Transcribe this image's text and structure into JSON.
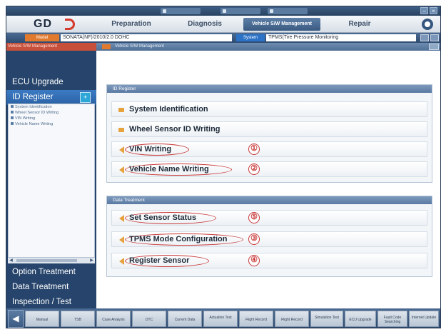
{
  "titlebar": {
    "tabs": [
      "",
      "",
      ""
    ],
    "buttons": [
      "–",
      "×"
    ]
  },
  "nav": {
    "logo": "GD",
    "tabs": [
      {
        "label": "Preparation",
        "active": false
      },
      {
        "label": "Diagnosis",
        "active": false
      },
      {
        "label": "Vehicle S/W Management",
        "active": true
      },
      {
        "label": "Repair",
        "active": false
      }
    ]
  },
  "vehicle": {
    "model_label": "Model",
    "model_value": "SONATA(NF)/2010/2.0 DOHC",
    "system_label": "System",
    "system_value": "TPMS(Tire Pressure Monitoring"
  },
  "sidebar": {
    "header": "Vehicle S/W Management",
    "items": [
      {
        "label": "ECU Upgrade"
      },
      {
        "label": "ID Register",
        "badge": "+"
      }
    ],
    "sub_items": [
      "System Identification",
      "Wheel Sensor ID Writing",
      "VIN Writing",
      "Vehicle Name Writing"
    ],
    "bottom_items": [
      {
        "label": "Option Treatment"
      },
      {
        "label": "Data Treatment"
      },
      {
        "label": "Inspection / Test"
      }
    ]
  },
  "content": {
    "header": "Vehicle S/W Management",
    "panels": [
      {
        "title": "ID Register",
        "rows": [
          {
            "label": "System Identification",
            "marker": ""
          },
          {
            "label": "Wheel Sensor ID Writing",
            "marker": ""
          },
          {
            "label": "VIN Writing",
            "marker": "①"
          },
          {
            "label": "Vehicle Name Writing",
            "marker": "②"
          }
        ]
      },
      {
        "title": "Data Treatment",
        "rows": [
          {
            "label": "Set Sensor Status",
            "marker": "⑤"
          },
          {
            "label": "TPMS Mode Configuration",
            "marker": "③"
          },
          {
            "label": "Register Sensor",
            "marker": "④"
          }
        ]
      }
    ]
  },
  "bottombar": {
    "home_icon": "◀",
    "buttons": [
      {
        "top": "",
        "label": "Manual"
      },
      {
        "top": "",
        "label": "TSB"
      },
      {
        "top": "",
        "label": "Case Analysis"
      },
      {
        "top": "",
        "label": "DTC"
      },
      {
        "top": "",
        "label": "Current Data"
      },
      {
        "top": "",
        "label": "Actuation Test"
      },
      {
        "top": "",
        "label": "Flight Record"
      },
      {
        "top": "",
        "label": "Flight Record"
      },
      {
        "top": "",
        "label": "Simulation Test"
      },
      {
        "top": "",
        "label": "ECU Upgrade"
      },
      {
        "top": "",
        "label": "Fault Code Searching"
      },
      {
        "top": "",
        "label": "Internet Update"
      }
    ]
  }
}
